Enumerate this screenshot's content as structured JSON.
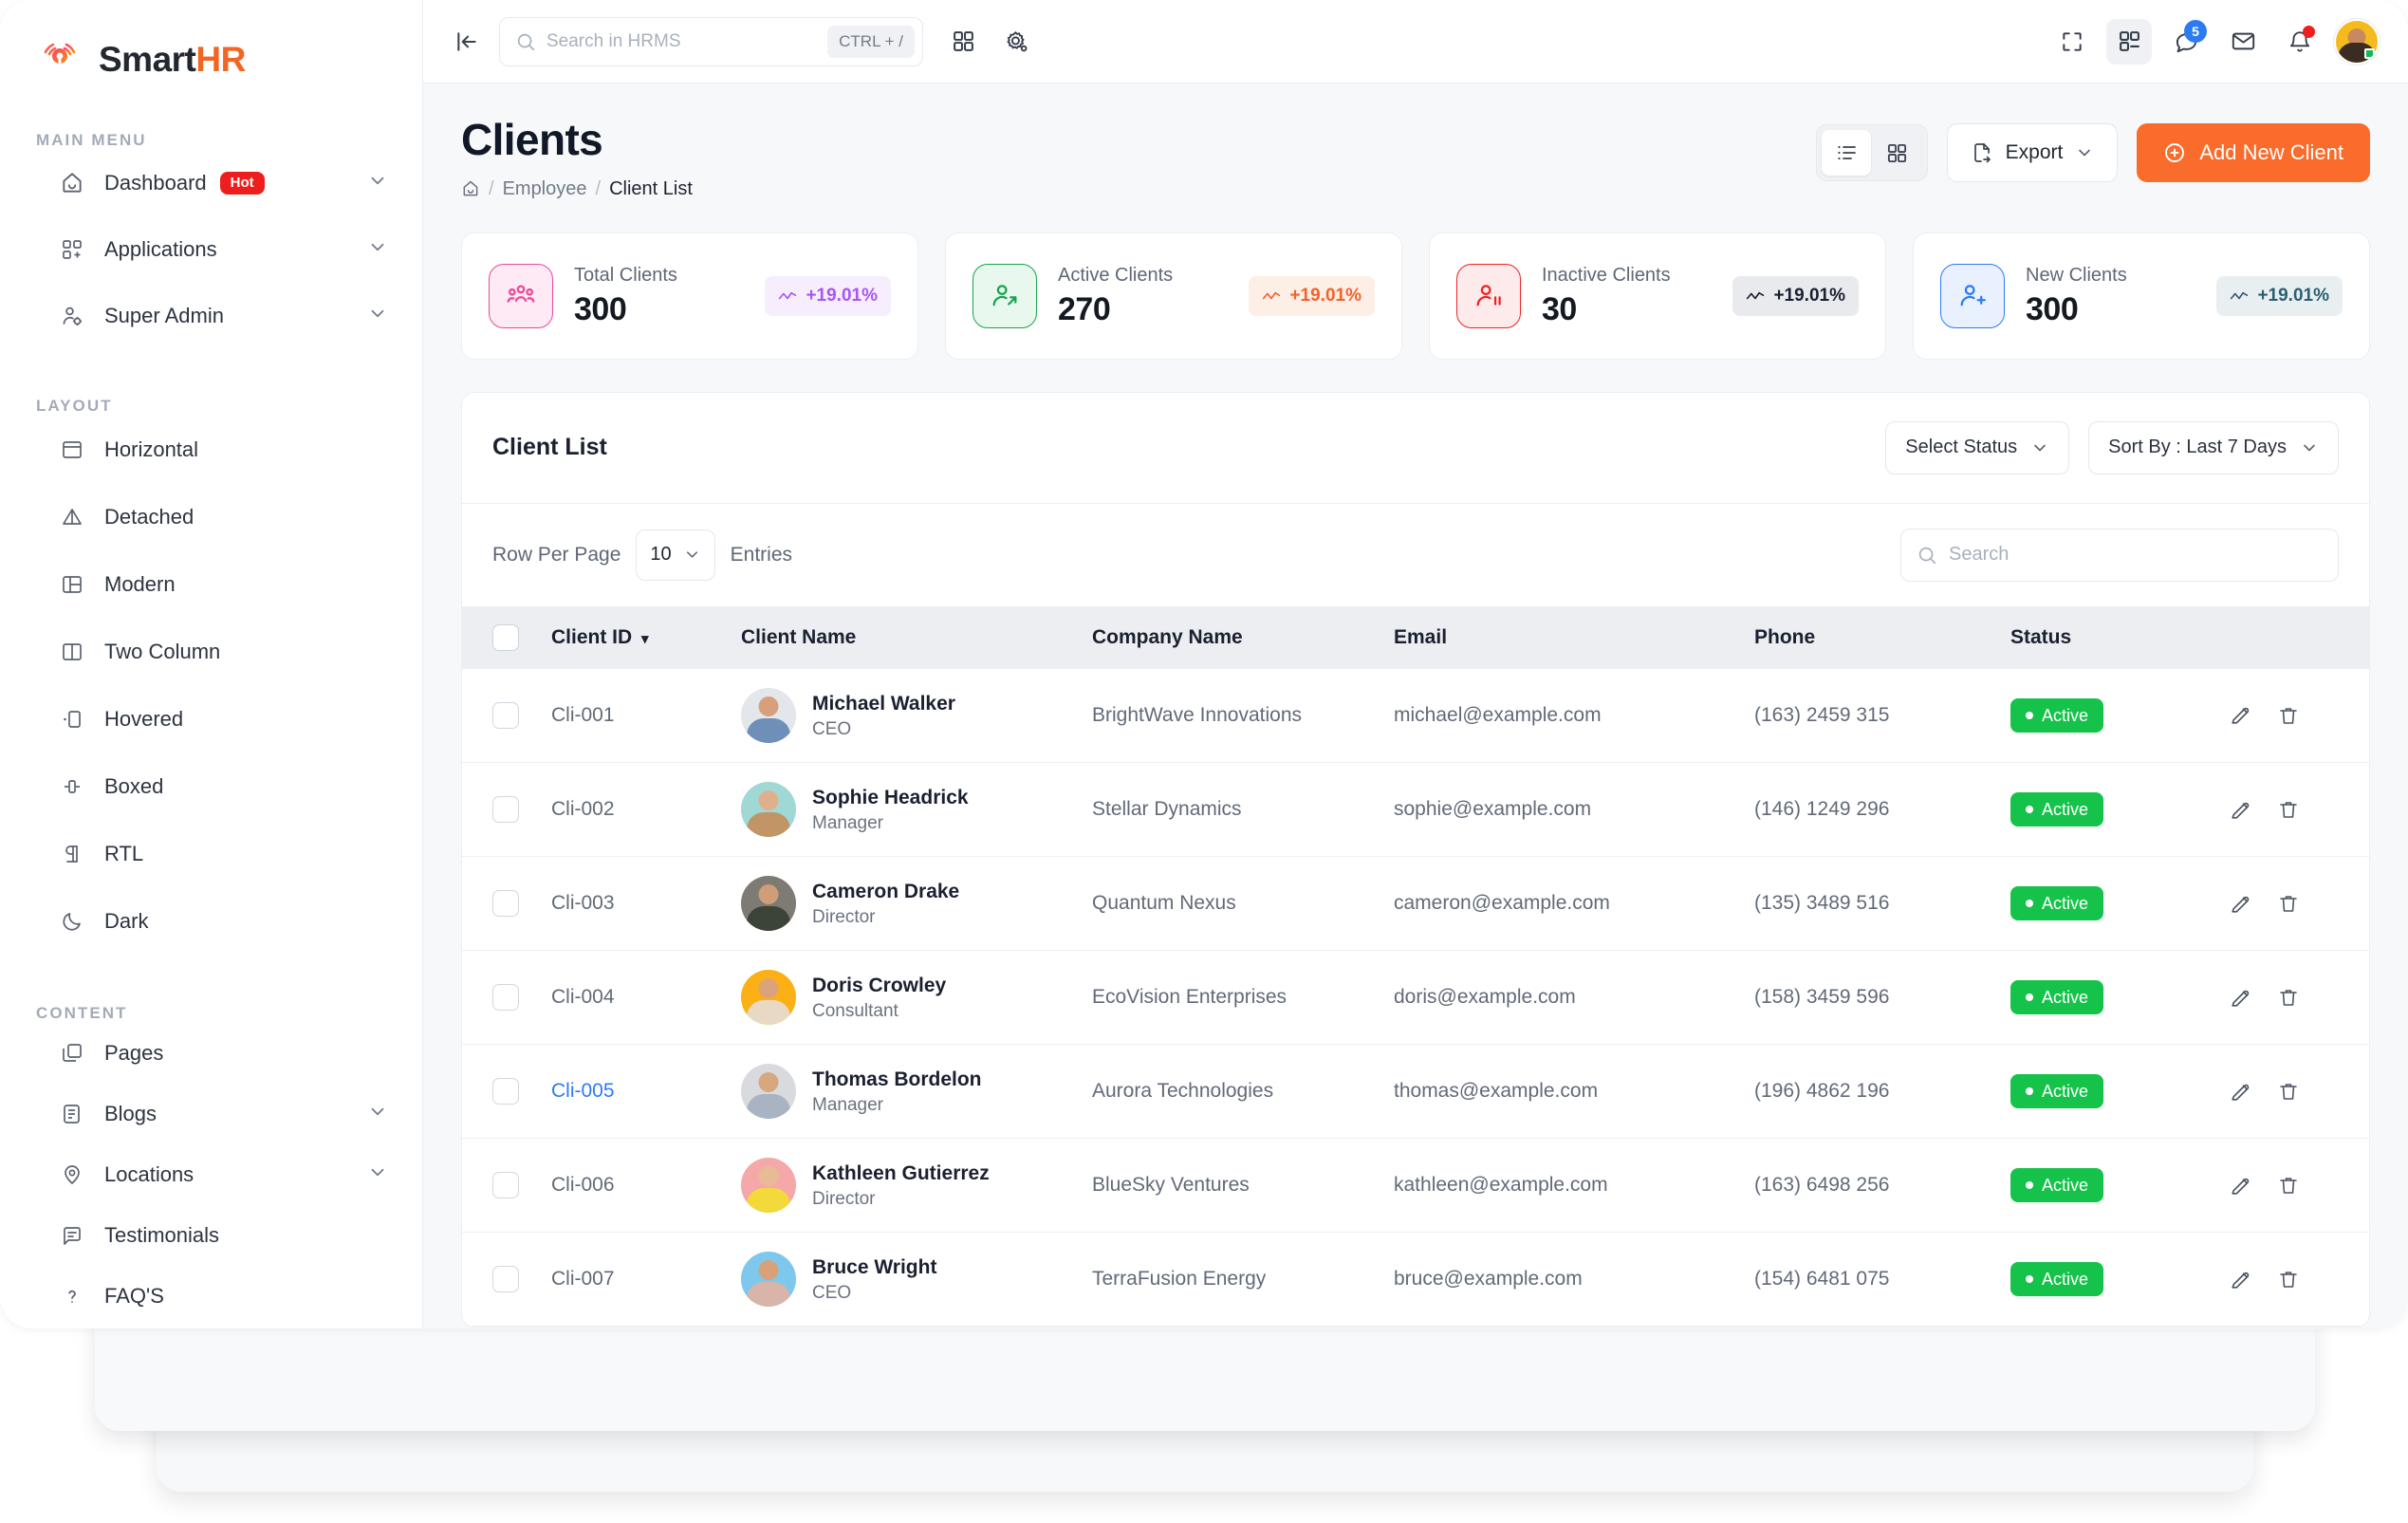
{
  "brand": {
    "name_1": "Smart",
    "name_2": "HR",
    "logo_icon": "smarthr-logo-icon"
  },
  "sidebar": {
    "sections": [
      {
        "title": "MAIN MENU",
        "items": [
          {
            "label": "Dashboard",
            "icon": "home-icon",
            "badge": "Hot",
            "caret": true
          },
          {
            "label": "Applications",
            "icon": "grid-apps-icon",
            "caret": true
          },
          {
            "label": "Super Admin",
            "icon": "user-gear-icon",
            "caret": true
          }
        ]
      },
      {
        "title": "LAYOUT",
        "items": [
          {
            "label": "Horizontal",
            "icon": "layout-horizontal-icon",
            "caret": false
          },
          {
            "label": "Detached",
            "icon": "triangle-detached-icon",
            "caret": false
          },
          {
            "label": "Modern",
            "icon": "layout-modern-icon",
            "caret": false
          },
          {
            "label": "Two Column",
            "icon": "layout-two-column-icon",
            "caret": false
          },
          {
            "label": "Hovered",
            "icon": "layout-hovered-icon",
            "caret": false
          },
          {
            "label": "Boxed",
            "icon": "layout-boxed-icon",
            "caret": false
          },
          {
            "label": "RTL",
            "icon": "rtl-text-icon",
            "caret": false
          },
          {
            "label": "Dark",
            "icon": "moon-icon",
            "caret": false
          }
        ]
      },
      {
        "title": "CONTENT",
        "items": [
          {
            "label": "Pages",
            "icon": "pages-copy-icon",
            "caret": false
          },
          {
            "label": "Blogs",
            "icon": "blog-icon",
            "caret": true
          },
          {
            "label": "Locations",
            "icon": "map-pin-icon",
            "caret": true
          },
          {
            "label": "Testimonials",
            "icon": "chat-quote-icon",
            "caret": false
          },
          {
            "label": "FAQ'S",
            "icon": "question-mark-icon",
            "caret": false
          }
        ]
      }
    ]
  },
  "topbar": {
    "collapse_icon": "sidebar-collapse-icon",
    "search": {
      "placeholder": "Search in HRMS",
      "value": "",
      "shortcut": "CTRL + /",
      "icon": "search-icon"
    },
    "left_icons": [
      {
        "name": "apps-grid-icon"
      },
      {
        "name": "settings-gear-icon"
      }
    ],
    "right_icons": [
      {
        "name": "fullscreen-icon",
        "badge": ""
      },
      {
        "name": "apps-dashboard-icon",
        "badge": "",
        "active": true
      },
      {
        "name": "chat-icon",
        "badge": "5"
      },
      {
        "name": "mail-envelope-icon",
        "badge": ""
      },
      {
        "name": "bell-notification-icon",
        "badge": "dot"
      }
    ],
    "avatar": {
      "name": "profile-avatar"
    }
  },
  "page": {
    "title": "Clients",
    "breadcrumb": {
      "home_icon": "home-icon",
      "sep": "/",
      "parent": "Employee",
      "current": "Client List"
    },
    "actions": {
      "view_list_icon": "list-view-icon",
      "view_grid_icon": "grid-view-icon",
      "export_label": "Export",
      "export_icon": "file-export-icon",
      "export_caret_icon": "chevron-down-icon",
      "add_label": "Add New Client",
      "add_icon": "plus-circle-icon"
    }
  },
  "stats": [
    {
      "label": "Total Clients",
      "value": "300",
      "trend": "+19.01%",
      "icon": "users-group-icon",
      "icon_color": "#ec4899",
      "icon_bg": "#fdeaf4",
      "icon_border": "#ec4899",
      "trend_color": "#a855f7",
      "trend_bg": "#f6edfd",
      "trend_icon": "trend-wave-icon"
    },
    {
      "label": "Active Clients",
      "value": "270",
      "trend": "+19.01%",
      "icon": "user-active-icon",
      "icon_color": "#17a54a",
      "icon_bg": "#e8f8ee",
      "icon_border": "#17a54a",
      "trend_color": "#f4622a",
      "trend_bg": "#fdeee6",
      "trend_icon": "trend-wave-icon"
    },
    {
      "label": "Inactive Clients",
      "value": "30",
      "trend": "+19.01%",
      "icon": "user-pause-icon",
      "icon_color": "#ef2222",
      "icon_bg": "#fdebeb",
      "icon_border": "#ef2222",
      "trend_color": "#1b2030",
      "trend_bg": "#e9eaed",
      "trend_icon": "trend-wave-icon"
    },
    {
      "label": "New Clients",
      "value": "300",
      "trend": "+19.01%",
      "icon": "user-plus-icon",
      "icon_color": "#2d7bf4",
      "icon_bg": "#e9f1fe",
      "icon_border": "#2d7bf4",
      "trend_color": "#2b5f73",
      "trend_bg": "#e9eef0",
      "trend_icon": "trend-wave-icon"
    }
  ],
  "client_list": {
    "title": "Client List",
    "status_filter": {
      "label": "Select Status",
      "caret_icon": "chevron-down-icon"
    },
    "sort_filter": {
      "label": "Sort By :  Last 7 Days",
      "caret_icon": "chevron-down-icon"
    },
    "row_per_page": {
      "prefix": "Row Per Page",
      "value": "10",
      "suffix": "Entries",
      "caret_icon": "chevron-down-icon"
    },
    "search": {
      "placeholder": "Search",
      "value": "",
      "icon": "search-icon"
    },
    "columns": [
      {
        "key": "checkbox",
        "label": ""
      },
      {
        "key": "id",
        "label": "Client ID",
        "sort_icon": "sort-caret-icon"
      },
      {
        "key": "name",
        "label": "Client Name"
      },
      {
        "key": "company",
        "label": "Company Name"
      },
      {
        "key": "email",
        "label": "Email"
      },
      {
        "key": "phone",
        "label": "Phone"
      },
      {
        "key": "status",
        "label": "Status"
      },
      {
        "key": "actions",
        "label": ""
      }
    ],
    "rows": [
      {
        "id": "Cli-001",
        "id_highlight": false,
        "name": "Michael Walker",
        "role": "CEO",
        "company": "BrightWave Innovations",
        "email": "michael@example.com",
        "phone": "(163) 2459 315",
        "status": "Active",
        "avatar_bg": "#e3e6ea",
        "avatar_head": "#d8a07a",
        "avatar_body": "#6e8fb8"
      },
      {
        "id": "Cli-002",
        "id_highlight": false,
        "name": "Sophie Headrick",
        "role": "Manager",
        "company": "Stellar Dynamics",
        "email": "sophie@example.com",
        "phone": "(146) 1249 296",
        "status": "Active",
        "avatar_bg": "#9fd8d4",
        "avatar_head": "#e0b08c",
        "avatar_body": "#c29566"
      },
      {
        "id": "Cli-003",
        "id_highlight": false,
        "name": "Cameron Drake",
        "role": "Director",
        "company": "Quantum Nexus",
        "email": "cameron@example.com",
        "phone": "(135) 3489 516",
        "status": "Active",
        "avatar_bg": "#7e7a74",
        "avatar_head": "#cf9d77",
        "avatar_body": "#3c4438"
      },
      {
        "id": "Cli-004",
        "id_highlight": false,
        "name": "Doris Crowley",
        "role": "Consultant",
        "company": "EcoVision Enterprises",
        "email": "doris@example.com",
        "phone": "(158) 3459 596",
        "status": "Active",
        "avatar_bg": "#fbb016",
        "avatar_head": "#dba37c",
        "avatar_body": "#e8d9c4"
      },
      {
        "id": "Cli-005",
        "id_highlight": true,
        "name": "Thomas Bordelon",
        "role": "Manager",
        "company": "Aurora Technologies",
        "email": "thomas@example.com",
        "phone": "(196) 4862 196",
        "status": "Active",
        "avatar_bg": "#d9dade",
        "avatar_head": "#d8a77f",
        "avatar_body": "#a8b4c2"
      },
      {
        "id": "Cli-006",
        "id_highlight": false,
        "name": "Kathleen Gutierrez",
        "role": "Director",
        "company": "BlueSky Ventures",
        "email": "kathleen@example.com",
        "phone": "(163) 6498 256",
        "status": "Active",
        "avatar_bg": "#f4a8a8",
        "avatar_head": "#e8bb94",
        "avatar_body": "#f4d93a"
      },
      {
        "id": "Cli-007",
        "id_highlight": false,
        "name": "Bruce Wright",
        "role": "CEO",
        "company": "TerraFusion Energy",
        "email": "bruce@example.com",
        "phone": "(154) 6481 075",
        "status": "Active",
        "avatar_bg": "#7ec8ee",
        "avatar_head": "#d9a177",
        "avatar_body": "#d8b5a8"
      }
    ],
    "row_actions": {
      "edit_icon": "edit-pencil-icon",
      "delete_icon": "trash-delete-icon"
    }
  },
  "colors": {
    "accent": "#f96c2c",
    "status_active": "#16c34a",
    "link": "#2d7bf4",
    "page_bg": "#f7f8fa"
  }
}
